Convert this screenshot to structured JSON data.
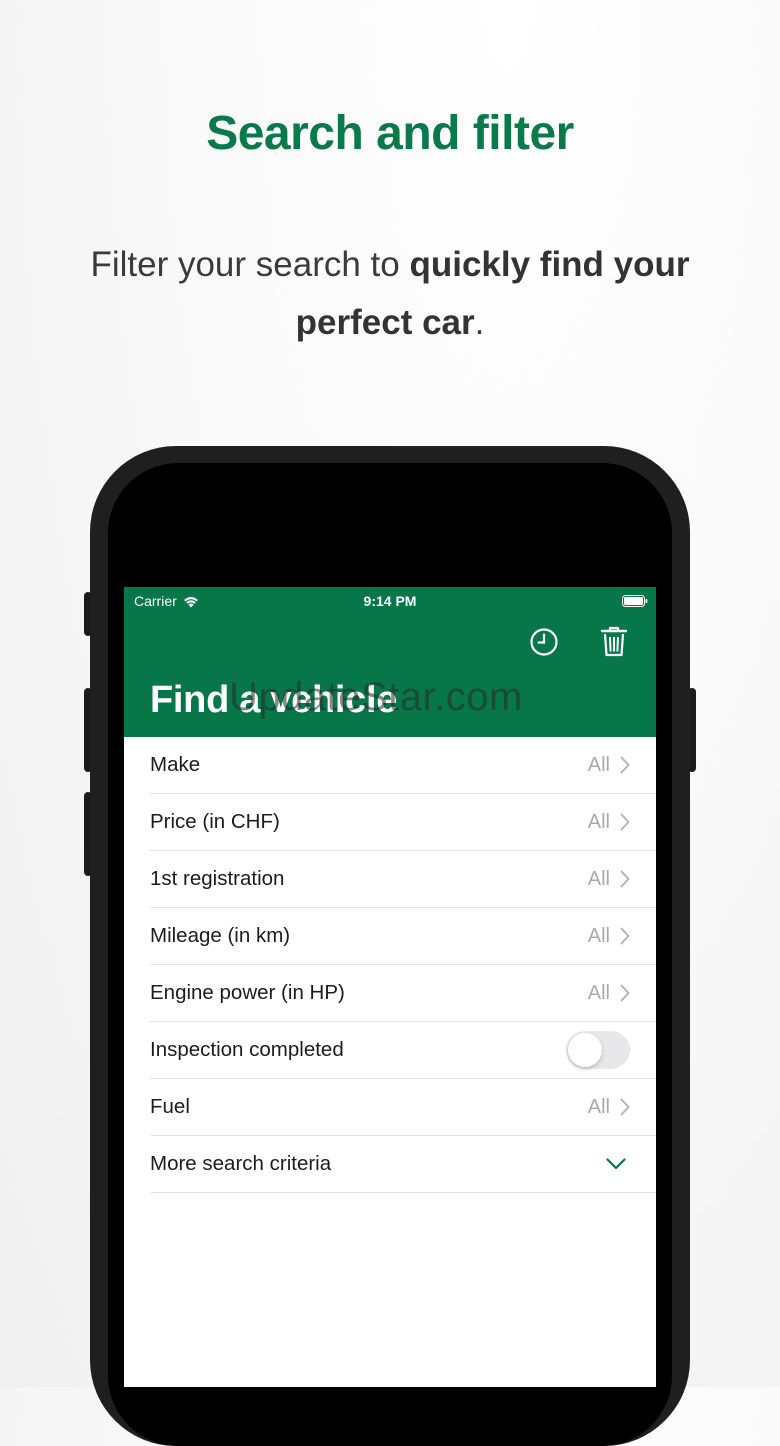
{
  "promo": {
    "title": "Search and filter",
    "subtitle_part1": "Filter your search to ",
    "subtitle_bold": "quickly find your perfect car",
    "subtitle_end": "."
  },
  "status_bar": {
    "carrier": "Carrier",
    "time": "9:14 PM"
  },
  "app": {
    "title": "Find a vehicle",
    "accent_color": "#07774a",
    "actions": [
      {
        "icon": "history-clock-icon"
      },
      {
        "icon": "trash-icon"
      }
    ]
  },
  "watermark": "UpdateStar.com",
  "filters": [
    {
      "label": "Make",
      "value": "All"
    },
    {
      "label": "Price (in CHF)",
      "value": "All"
    },
    {
      "label": "1st registration",
      "value": "All"
    },
    {
      "label": "Mileage (in km)",
      "value": "All"
    },
    {
      "label": "Engine power (in HP)",
      "value": "All"
    },
    {
      "label": "Inspection completed",
      "toggle": false
    },
    {
      "label": "Fuel",
      "value": "All"
    },
    {
      "label": "More search criteria",
      "expand": true
    }
  ]
}
